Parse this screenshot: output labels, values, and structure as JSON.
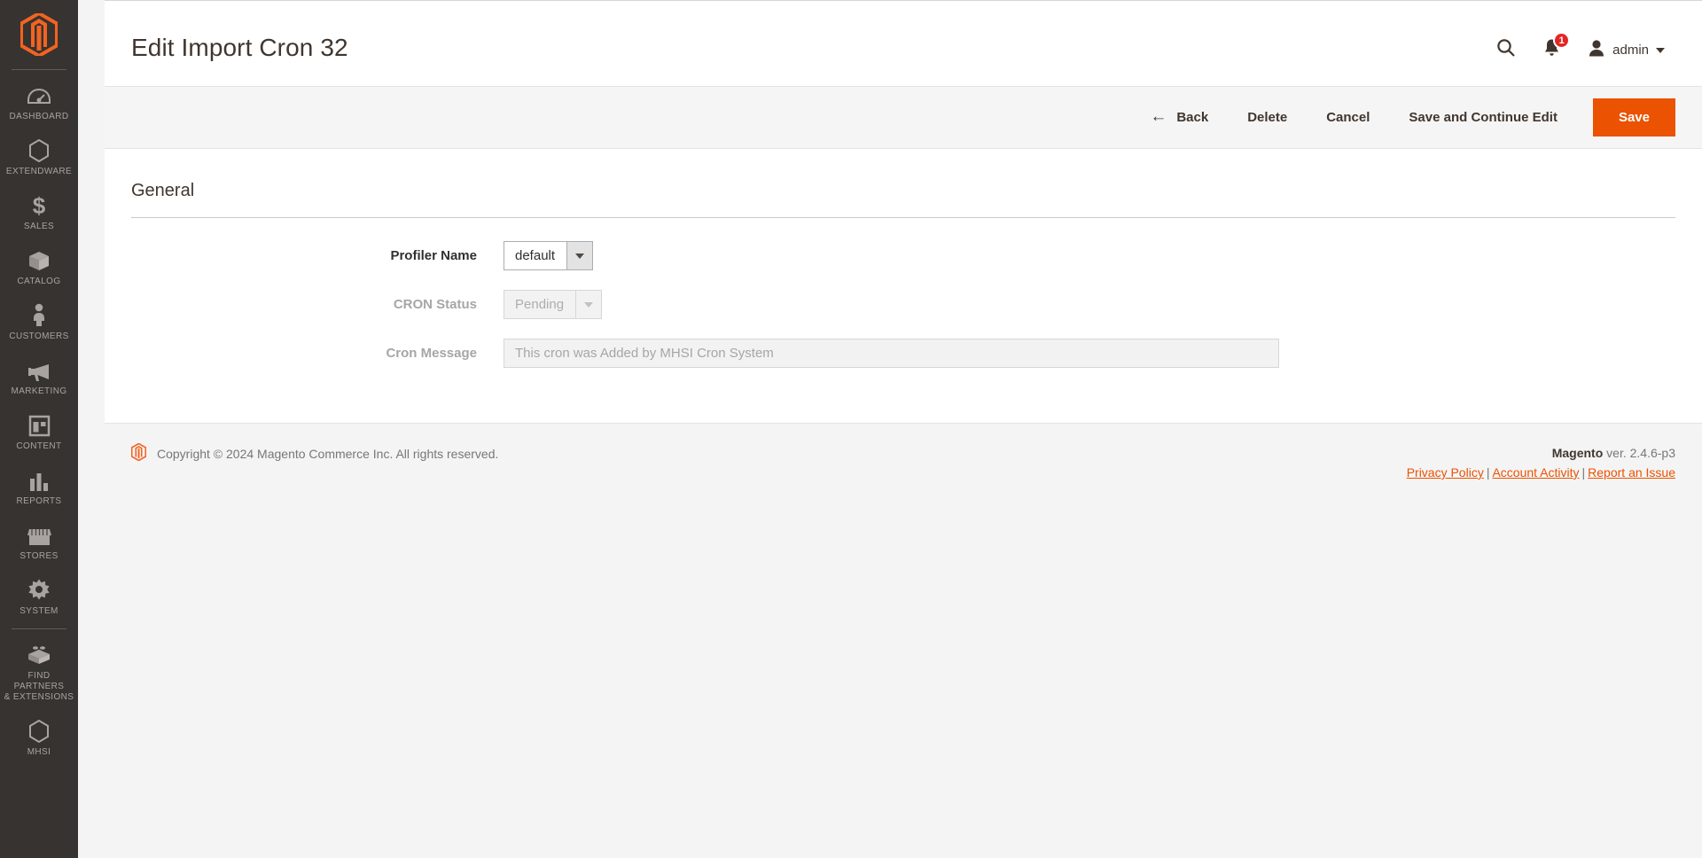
{
  "sidebar": {
    "logo_alt": "magento-logo",
    "items": [
      {
        "label": "Dashboard",
        "icon": "dashboard-icon"
      },
      {
        "label": "Extendware",
        "icon": "hexagon-icon"
      },
      {
        "label": "Sales",
        "icon": "dollar-icon"
      },
      {
        "label": "Catalog",
        "icon": "box-icon"
      },
      {
        "label": "Customers",
        "icon": "person-icon"
      },
      {
        "label": "Marketing",
        "icon": "megaphone-icon"
      },
      {
        "label": "Content",
        "icon": "layout-icon"
      },
      {
        "label": "Reports",
        "icon": "bar-chart-icon"
      },
      {
        "label": "Stores",
        "icon": "storefront-icon"
      },
      {
        "label": "System",
        "icon": "gear-icon"
      },
      {
        "label": "Find Partners\n& Extensions",
        "icon": "lego-brick-icon"
      },
      {
        "label": "MHSI",
        "icon": "hexagon-icon"
      }
    ]
  },
  "header": {
    "title": "Edit Import Cron 32",
    "search_icon": "search-icon",
    "notifications_icon": "bell-icon",
    "notifications_count": "1",
    "user_icon": "user-avatar-icon",
    "user_name": "admin"
  },
  "toolbar": {
    "back_label": "Back",
    "back_arrow": "←",
    "delete_label": "Delete",
    "cancel_label": "Cancel",
    "save_continue_label": "Save and Continue Edit",
    "save_label": "Save",
    "primary_color": "#eb5202"
  },
  "content": {
    "section_title": "General",
    "fields": {
      "profiler_name": {
        "label": "Profiler Name",
        "value": "default",
        "disabled": false
      },
      "cron_status": {
        "label": "CRON Status",
        "value": "Pending",
        "disabled": true
      },
      "cron_message": {
        "label": "Cron Message",
        "value": "",
        "placeholder": "This cron was Added by MHSI Cron System",
        "disabled": true
      }
    }
  },
  "footer": {
    "copyright": "Copyright © 2024 Magento Commerce Inc. All rights reserved.",
    "version_brand": "Magento",
    "version_text": " ver. 2.4.6-p3",
    "links": [
      {
        "label": "Privacy Policy"
      },
      {
        "label": "Account Activity"
      },
      {
        "label": "Report an Issue"
      }
    ],
    "separator": "|"
  }
}
